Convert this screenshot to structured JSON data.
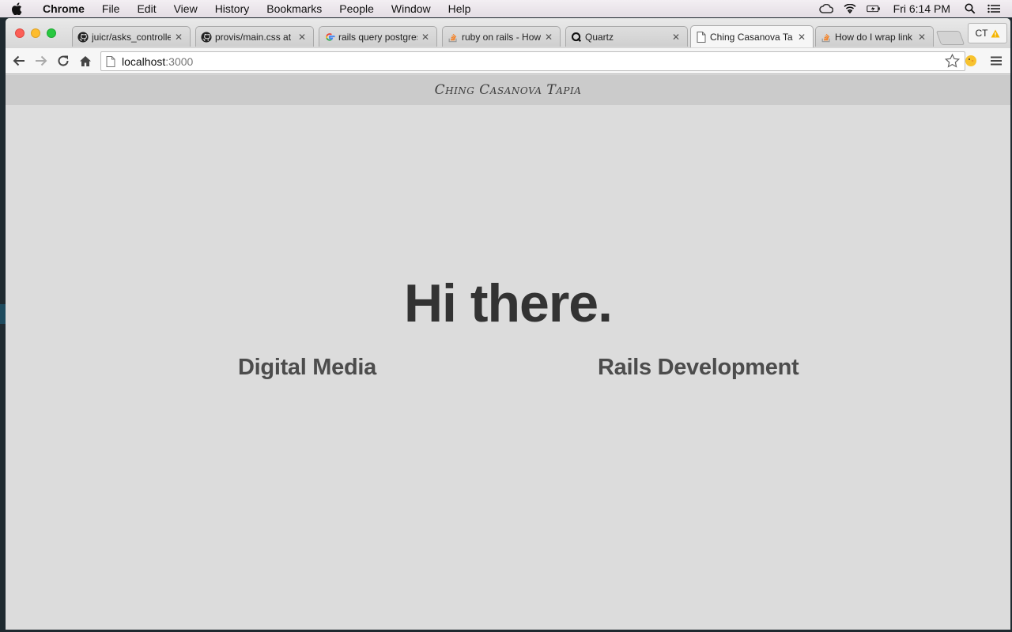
{
  "menubar": {
    "apple_icon": "apple-logo-icon",
    "app_name": "Chrome",
    "menus": [
      "File",
      "Edit",
      "View",
      "History",
      "Bookmarks",
      "People",
      "Window",
      "Help"
    ],
    "clock": "Fri 6:14 PM",
    "status_icons": [
      "creative-cloud-icon",
      "wifi-icon",
      "battery-icon",
      "spotlight-search-icon",
      "notification-center-icon"
    ]
  },
  "tabs": [
    {
      "title": "juicr/asks_controlle",
      "icon": "github-icon",
      "active": false
    },
    {
      "title": "provis/main.css at n",
      "icon": "github-icon",
      "active": false
    },
    {
      "title": "rails query postgres",
      "icon": "google-icon",
      "active": false
    },
    {
      "title": "ruby on rails - How",
      "icon": "stackoverflow-icon",
      "active": false
    },
    {
      "title": "Quartz",
      "icon": "quartz-icon",
      "active": false
    },
    {
      "title": "Ching Casanova Ta",
      "icon": "page-icon",
      "active": true
    },
    {
      "title": "How do I wrap link",
      "icon": "stackoverflow-icon",
      "active": false
    }
  ],
  "profile": {
    "initials": "CT",
    "warning_icon": "warning-icon"
  },
  "address_bar": {
    "host": "localhost",
    "port": ":3000"
  },
  "page": {
    "site_title": "Ching Casanova Tapia",
    "heading": "Hi there.",
    "links": [
      "Digital Media",
      "Rails Development"
    ]
  },
  "colors": {
    "page_background": "#dcdcdc",
    "header_background": "#cbcbcb",
    "heading_text": "#333333",
    "link_text": "#4c4c4c"
  }
}
